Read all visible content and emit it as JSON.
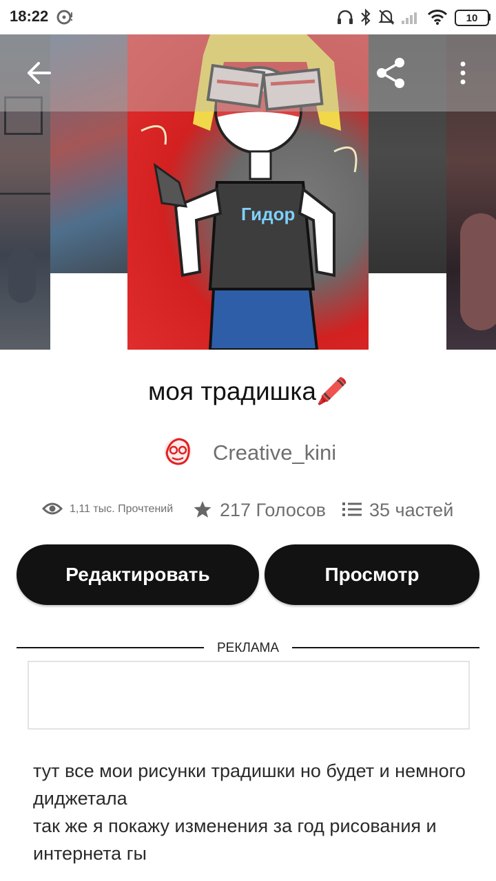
{
  "status_bar": {
    "time": "18:22",
    "battery": "10"
  },
  "top_bar": {
    "back_icon": "arrow-left-icon",
    "share_icon": "share-icon",
    "more_icon": "more-vertical-icon"
  },
  "story": {
    "title": "моя традишка",
    "title_emoji": "🖍️",
    "author": "Creative_kini",
    "stats": {
      "reads": "1,11 тыс. Прочтений",
      "votes": "217 Голосов",
      "parts": "35 частей"
    }
  },
  "buttons": {
    "edit": "Редактировать",
    "view": "Просмотр"
  },
  "ad": {
    "label": "РЕКЛАМА"
  },
  "description": {
    "line1": "тут все мои рисунки традишки но будет и немного диджетала",
    "line2": "так же я покажу изменения за год рисования и интернета гы"
  },
  "colors": {
    "button_bg": "#121212",
    "muted_text": "#6f6f6f",
    "accent_red": "#e02020"
  }
}
